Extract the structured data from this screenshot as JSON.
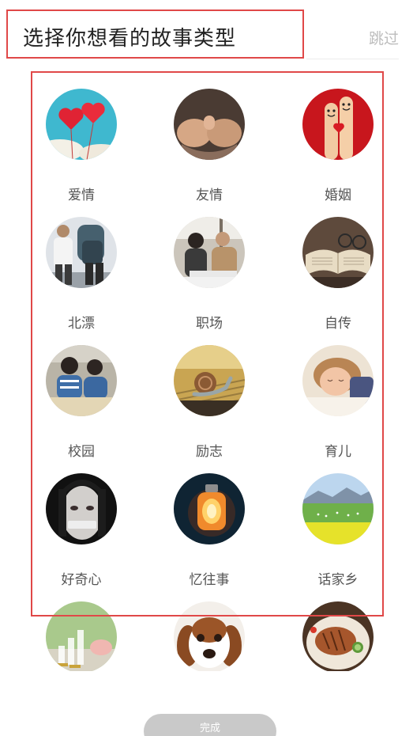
{
  "header": {
    "title": "选择你想看的故事类型",
    "skip_label": "跳过"
  },
  "categories": [
    {
      "label": "爱情",
      "icon": "heart-balloons-icon"
    },
    {
      "label": "友情",
      "icon": "pinky-promise-icon"
    },
    {
      "label": "婚姻",
      "icon": "finger-couple-icon"
    },
    {
      "label": "北漂",
      "icon": "backpacker-icon"
    },
    {
      "label": "职场",
      "icon": "office-meeting-icon"
    },
    {
      "label": "自传",
      "icon": "open-book-icon"
    },
    {
      "label": "校园",
      "icon": "students-icon"
    },
    {
      "label": "励志",
      "icon": "snail-icon"
    },
    {
      "label": "育儿",
      "icon": "sleeping-child-icon"
    },
    {
      "label": "好奇心",
      "icon": "taped-mouth-icon"
    },
    {
      "label": "忆往事",
      "icon": "glowing-jar-icon"
    },
    {
      "label": "话家乡",
      "icon": "countryside-icon"
    },
    {
      "label": "",
      "icon": "piggy-bank-icon"
    },
    {
      "label": "",
      "icon": "puppy-icon"
    },
    {
      "label": "",
      "icon": "food-plate-icon"
    }
  ],
  "footer": {
    "done_label": "完成"
  },
  "colors": {
    "highlight_border": "#e04848",
    "done_button_bg": "#c9c9c9",
    "skip_text": "#bdbdbd"
  }
}
